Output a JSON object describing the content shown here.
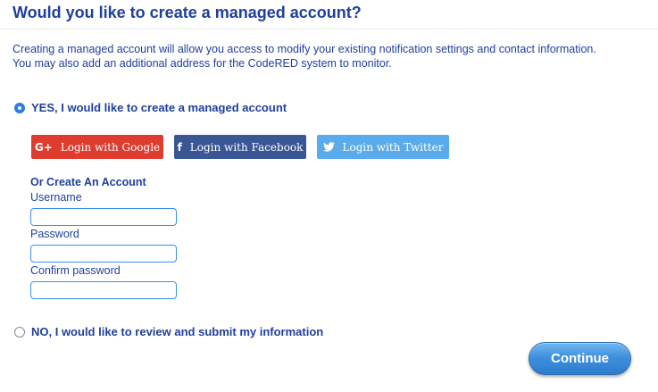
{
  "heading": "Would you like to create a managed account?",
  "intro": {
    "line1": "Creating a managed account will allow you access to modify your existing notification settings and contact information.",
    "line2": "You may also add an additional address for the CodeRED system to monitor."
  },
  "options": {
    "yes_label": "YES, I would like to create a managed account",
    "yes_selected": true,
    "no_label": "NO, I would like to review and submit my information",
    "no_selected": false
  },
  "social": {
    "google": {
      "icon": "google-plus-icon",
      "glyph": "G+",
      "label": "Login with Google",
      "color": "#dd3c2f"
    },
    "facebook": {
      "icon": "facebook-icon",
      "glyph": "f",
      "label": "Login with Facebook",
      "color": "#3a5694"
    },
    "twitter": {
      "icon": "twitter-icon",
      "label": "Login with Twitter",
      "color": "#5aabeb"
    }
  },
  "create_account": {
    "title": "Or Create An Account",
    "username_label": "Username",
    "username_value": "",
    "password_label": "Password",
    "password_value": "",
    "confirm_label": "Confirm password",
    "confirm_value": ""
  },
  "continue_label": "Continue",
  "colors": {
    "text": "#1f3f9e",
    "accent": "#2a7ee5"
  }
}
